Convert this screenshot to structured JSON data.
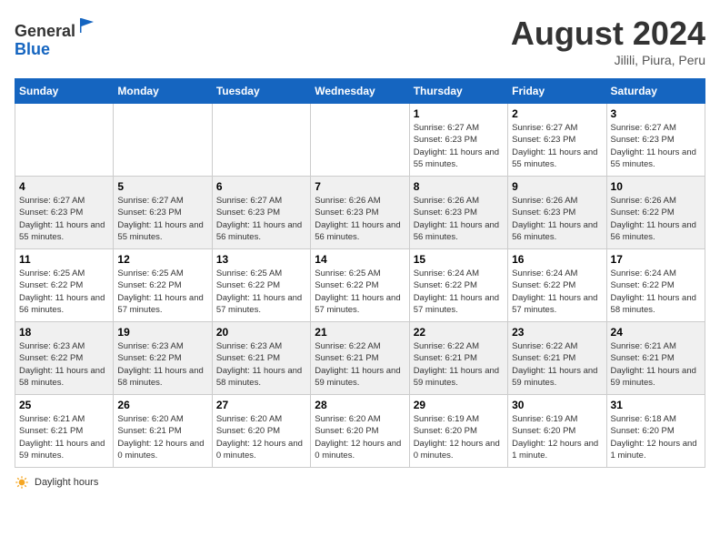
{
  "header": {
    "logo_general": "General",
    "logo_blue": "Blue",
    "month_year": "August 2024",
    "location": "Jilili, Piura, Peru"
  },
  "days_of_week": [
    "Sunday",
    "Monday",
    "Tuesday",
    "Wednesday",
    "Thursday",
    "Friday",
    "Saturday"
  ],
  "weeks": [
    [
      {
        "day": "",
        "info": ""
      },
      {
        "day": "",
        "info": ""
      },
      {
        "day": "",
        "info": ""
      },
      {
        "day": "",
        "info": ""
      },
      {
        "day": "1",
        "info": "Sunrise: 6:27 AM\nSunset: 6:23 PM\nDaylight: 11 hours and 55 minutes."
      },
      {
        "day": "2",
        "info": "Sunrise: 6:27 AM\nSunset: 6:23 PM\nDaylight: 11 hours and 55 minutes."
      },
      {
        "day": "3",
        "info": "Sunrise: 6:27 AM\nSunset: 6:23 PM\nDaylight: 11 hours and 55 minutes."
      }
    ],
    [
      {
        "day": "4",
        "info": "Sunrise: 6:27 AM\nSunset: 6:23 PM\nDaylight: 11 hours and 55 minutes."
      },
      {
        "day": "5",
        "info": "Sunrise: 6:27 AM\nSunset: 6:23 PM\nDaylight: 11 hours and 55 minutes."
      },
      {
        "day": "6",
        "info": "Sunrise: 6:27 AM\nSunset: 6:23 PM\nDaylight: 11 hours and 56 minutes."
      },
      {
        "day": "7",
        "info": "Sunrise: 6:26 AM\nSunset: 6:23 PM\nDaylight: 11 hours and 56 minutes."
      },
      {
        "day": "8",
        "info": "Sunrise: 6:26 AM\nSunset: 6:23 PM\nDaylight: 11 hours and 56 minutes."
      },
      {
        "day": "9",
        "info": "Sunrise: 6:26 AM\nSunset: 6:23 PM\nDaylight: 11 hours and 56 minutes."
      },
      {
        "day": "10",
        "info": "Sunrise: 6:26 AM\nSunset: 6:22 PM\nDaylight: 11 hours and 56 minutes."
      }
    ],
    [
      {
        "day": "11",
        "info": "Sunrise: 6:25 AM\nSunset: 6:22 PM\nDaylight: 11 hours and 56 minutes."
      },
      {
        "day": "12",
        "info": "Sunrise: 6:25 AM\nSunset: 6:22 PM\nDaylight: 11 hours and 57 minutes."
      },
      {
        "day": "13",
        "info": "Sunrise: 6:25 AM\nSunset: 6:22 PM\nDaylight: 11 hours and 57 minutes."
      },
      {
        "day": "14",
        "info": "Sunrise: 6:25 AM\nSunset: 6:22 PM\nDaylight: 11 hours and 57 minutes."
      },
      {
        "day": "15",
        "info": "Sunrise: 6:24 AM\nSunset: 6:22 PM\nDaylight: 11 hours and 57 minutes."
      },
      {
        "day": "16",
        "info": "Sunrise: 6:24 AM\nSunset: 6:22 PM\nDaylight: 11 hours and 57 minutes."
      },
      {
        "day": "17",
        "info": "Sunrise: 6:24 AM\nSunset: 6:22 PM\nDaylight: 11 hours and 58 minutes."
      }
    ],
    [
      {
        "day": "18",
        "info": "Sunrise: 6:23 AM\nSunset: 6:22 PM\nDaylight: 11 hours and 58 minutes."
      },
      {
        "day": "19",
        "info": "Sunrise: 6:23 AM\nSunset: 6:22 PM\nDaylight: 11 hours and 58 minutes."
      },
      {
        "day": "20",
        "info": "Sunrise: 6:23 AM\nSunset: 6:21 PM\nDaylight: 11 hours and 58 minutes."
      },
      {
        "day": "21",
        "info": "Sunrise: 6:22 AM\nSunset: 6:21 PM\nDaylight: 11 hours and 59 minutes."
      },
      {
        "day": "22",
        "info": "Sunrise: 6:22 AM\nSunset: 6:21 PM\nDaylight: 11 hours and 59 minutes."
      },
      {
        "day": "23",
        "info": "Sunrise: 6:22 AM\nSunset: 6:21 PM\nDaylight: 11 hours and 59 minutes."
      },
      {
        "day": "24",
        "info": "Sunrise: 6:21 AM\nSunset: 6:21 PM\nDaylight: 11 hours and 59 minutes."
      }
    ],
    [
      {
        "day": "25",
        "info": "Sunrise: 6:21 AM\nSunset: 6:21 PM\nDaylight: 11 hours and 59 minutes."
      },
      {
        "day": "26",
        "info": "Sunrise: 6:20 AM\nSunset: 6:21 PM\nDaylight: 12 hours and 0 minutes."
      },
      {
        "day": "27",
        "info": "Sunrise: 6:20 AM\nSunset: 6:20 PM\nDaylight: 12 hours and 0 minutes."
      },
      {
        "day": "28",
        "info": "Sunrise: 6:20 AM\nSunset: 6:20 PM\nDaylight: 12 hours and 0 minutes."
      },
      {
        "day": "29",
        "info": "Sunrise: 6:19 AM\nSunset: 6:20 PM\nDaylight: 12 hours and 0 minutes."
      },
      {
        "day": "30",
        "info": "Sunrise: 6:19 AM\nSunset: 6:20 PM\nDaylight: 12 hours and 1 minute."
      },
      {
        "day": "31",
        "info": "Sunrise: 6:18 AM\nSunset: 6:20 PM\nDaylight: 12 hours and 1 minute."
      }
    ]
  ],
  "footer": {
    "daylight_hours_label": "Daylight hours"
  }
}
